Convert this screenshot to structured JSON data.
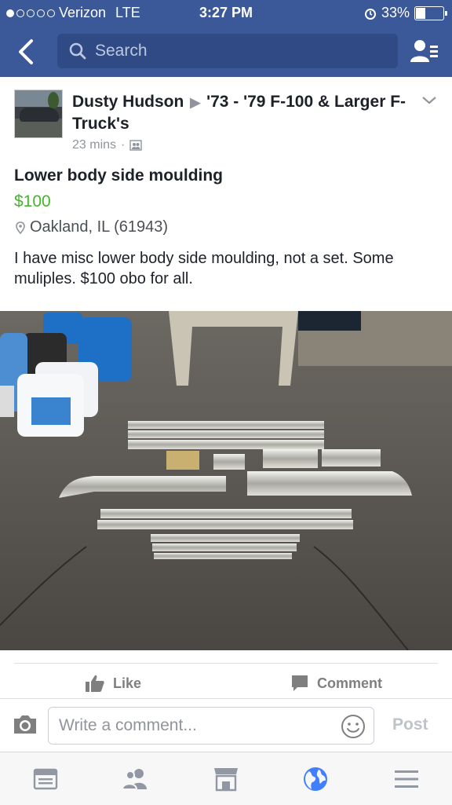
{
  "status_bar": {
    "carrier": "Verizon",
    "network": "LTE",
    "time": "3:27 PM",
    "battery": "33%",
    "battery_level": 0.33,
    "signal_bars_filled": 1,
    "signal_bars_total": 5
  },
  "nav": {
    "search_placeholder": "Search",
    "back_icon": "chevron-left-icon",
    "friends_icon": "friend-requests-icon"
  },
  "post": {
    "author": "Dusty Hudson",
    "group": "'73 - '79 F-100 & Larger F-Truck's",
    "time_ago": "23 mins",
    "separator": "·",
    "title": "Lower body side moulding",
    "price": "$100",
    "location": "Oakland, IL (61943)",
    "body": "I have misc lower body side moulding, not a set. Some muliples. $100 obo for all."
  },
  "actions": {
    "like_label": "Like",
    "comment_label": "Comment"
  },
  "comment_bar": {
    "placeholder": "Write a comment...",
    "post_label": "Post"
  },
  "colors": {
    "brand": "#3b5998",
    "price_green": "#42b72a",
    "active_tab": "#4080ff"
  },
  "tabbar": {
    "tabs": [
      "news-feed-icon",
      "friends-icon",
      "marketplace-icon",
      "notifications-globe-icon",
      "menu-icon"
    ],
    "active": "notifications-globe-icon"
  }
}
